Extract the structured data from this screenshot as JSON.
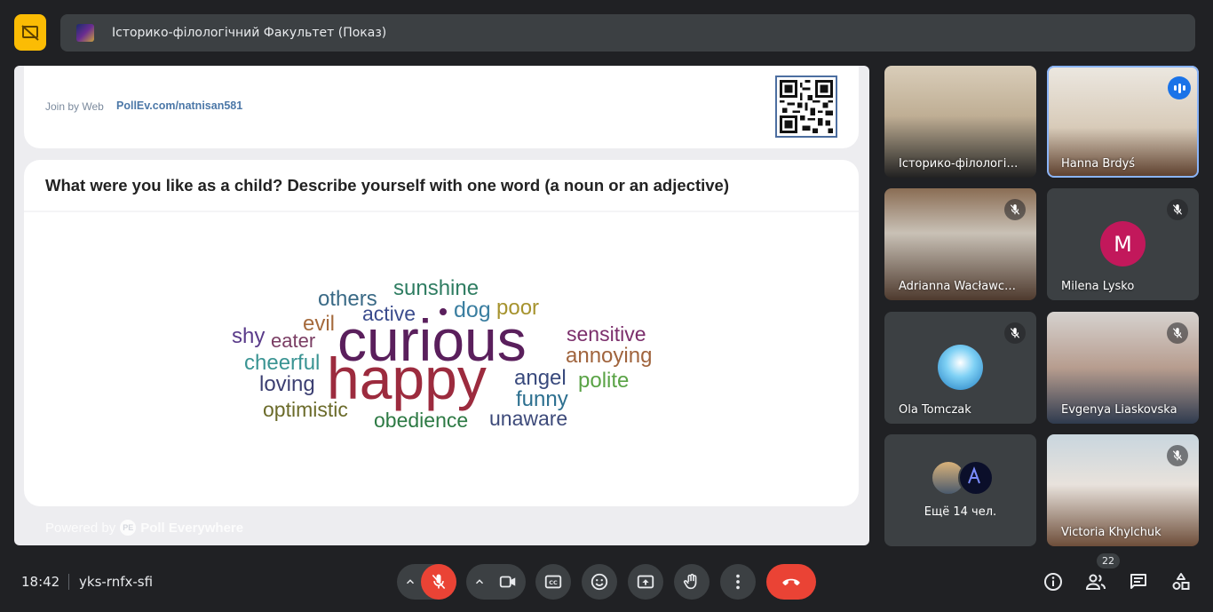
{
  "presentation_bar": {
    "title": "Історико-філологічний Факультет (Показ)"
  },
  "slide": {
    "join_label": "Join by Web",
    "join_url": "PollEv.com/natnisan581",
    "question": "What were you like as a child? Describe yourself with one word (a noun or an adjective)",
    "powered_by": "Powered by",
    "brand": "Poll Everywhere",
    "wordcloud": [
      {
        "text": "sunshine",
        "color": "#2f7d62"
      },
      {
        "text": "others",
        "color": "#3a6a86"
      },
      {
        "text": "active",
        "color": "#3b4c8d"
      },
      {
        "text": "dog",
        "color": "#3a7ea0"
      },
      {
        "text": "poor",
        "color": "#a6932e"
      },
      {
        "text": "evil",
        "color": "#a56a3c"
      },
      {
        "text": "shy",
        "color": "#5a3b8a"
      },
      {
        "text": "eater",
        "color": "#7a3d63"
      },
      {
        "text": "curious",
        "color": "#5a1f5c"
      },
      {
        "text": "sensitive",
        "color": "#7b2e6b"
      },
      {
        "text": "cheerful",
        "color": "#3a9493"
      },
      {
        "text": "happy",
        "color": "#9c2b3e"
      },
      {
        "text": "annoying",
        "color": "#a0643d"
      },
      {
        "text": "loving",
        "color": "#3c3f72"
      },
      {
        "text": "angel",
        "color": "#394a7d"
      },
      {
        "text": "polite",
        "color": "#5aa346"
      },
      {
        "text": "funny",
        "color": "#2c6f8f"
      },
      {
        "text": "optimistic",
        "color": "#6b6b2a"
      },
      {
        "text": "obedience",
        "color": "#2d7a44"
      },
      {
        "text": "unaware",
        "color": "#3d4a7a"
      }
    ]
  },
  "participants": [
    {
      "name": "Історико-філологі…"
    },
    {
      "name": "Hanna Brdyś"
    },
    {
      "name": "Adrianna Wacławc…"
    },
    {
      "name": "Milena Lysko",
      "initial": "M"
    },
    {
      "name": "Ola Tomczak"
    },
    {
      "name": "Evgenya Liaskovska"
    },
    {
      "more_label": "Ещё 14 чел."
    },
    {
      "name": "Victoria Khylchuk"
    }
  ],
  "bottom_bar": {
    "time": "18:42",
    "meeting_code": "yks-rnfx-sfi",
    "people_count": "22"
  },
  "colors": {
    "end_call": "#ea4335",
    "mic_off": "#ea4335",
    "present_accent": "#fbbc04",
    "active_speaker": "#1a73e8"
  }
}
